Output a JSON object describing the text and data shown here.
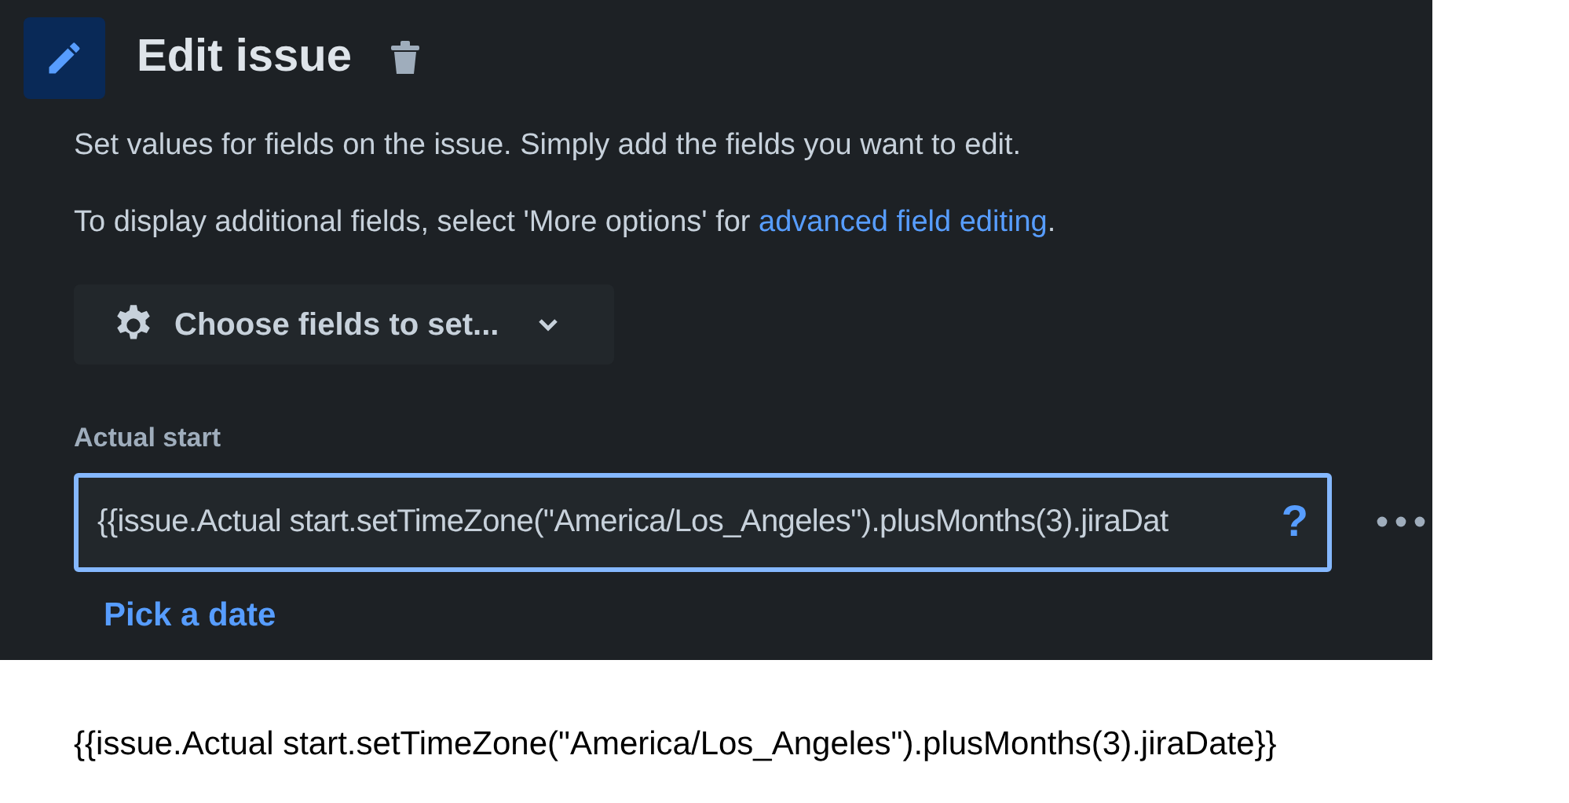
{
  "header": {
    "title": "Edit issue"
  },
  "description": "Set values for fields on the issue. Simply add the fields you want to edit.",
  "advanced_note": {
    "text": "To display additional fields, select 'More options' for ",
    "link": "advanced field editing",
    "suffix": "."
  },
  "choose_button": {
    "label": "Choose fields to set..."
  },
  "field": {
    "label": "Actual start",
    "value": "{{issue.Actual start.setTimeZone(\"America/Los_Angeles\").plusMonths(3).jiraDat",
    "focused": true,
    "help": "?",
    "link": "Pick a date"
  },
  "caption": "{{issue.Actual start.setTimeZone(\"America/Los_Angeles\").plusMonths(3).jiraDate}}"
}
